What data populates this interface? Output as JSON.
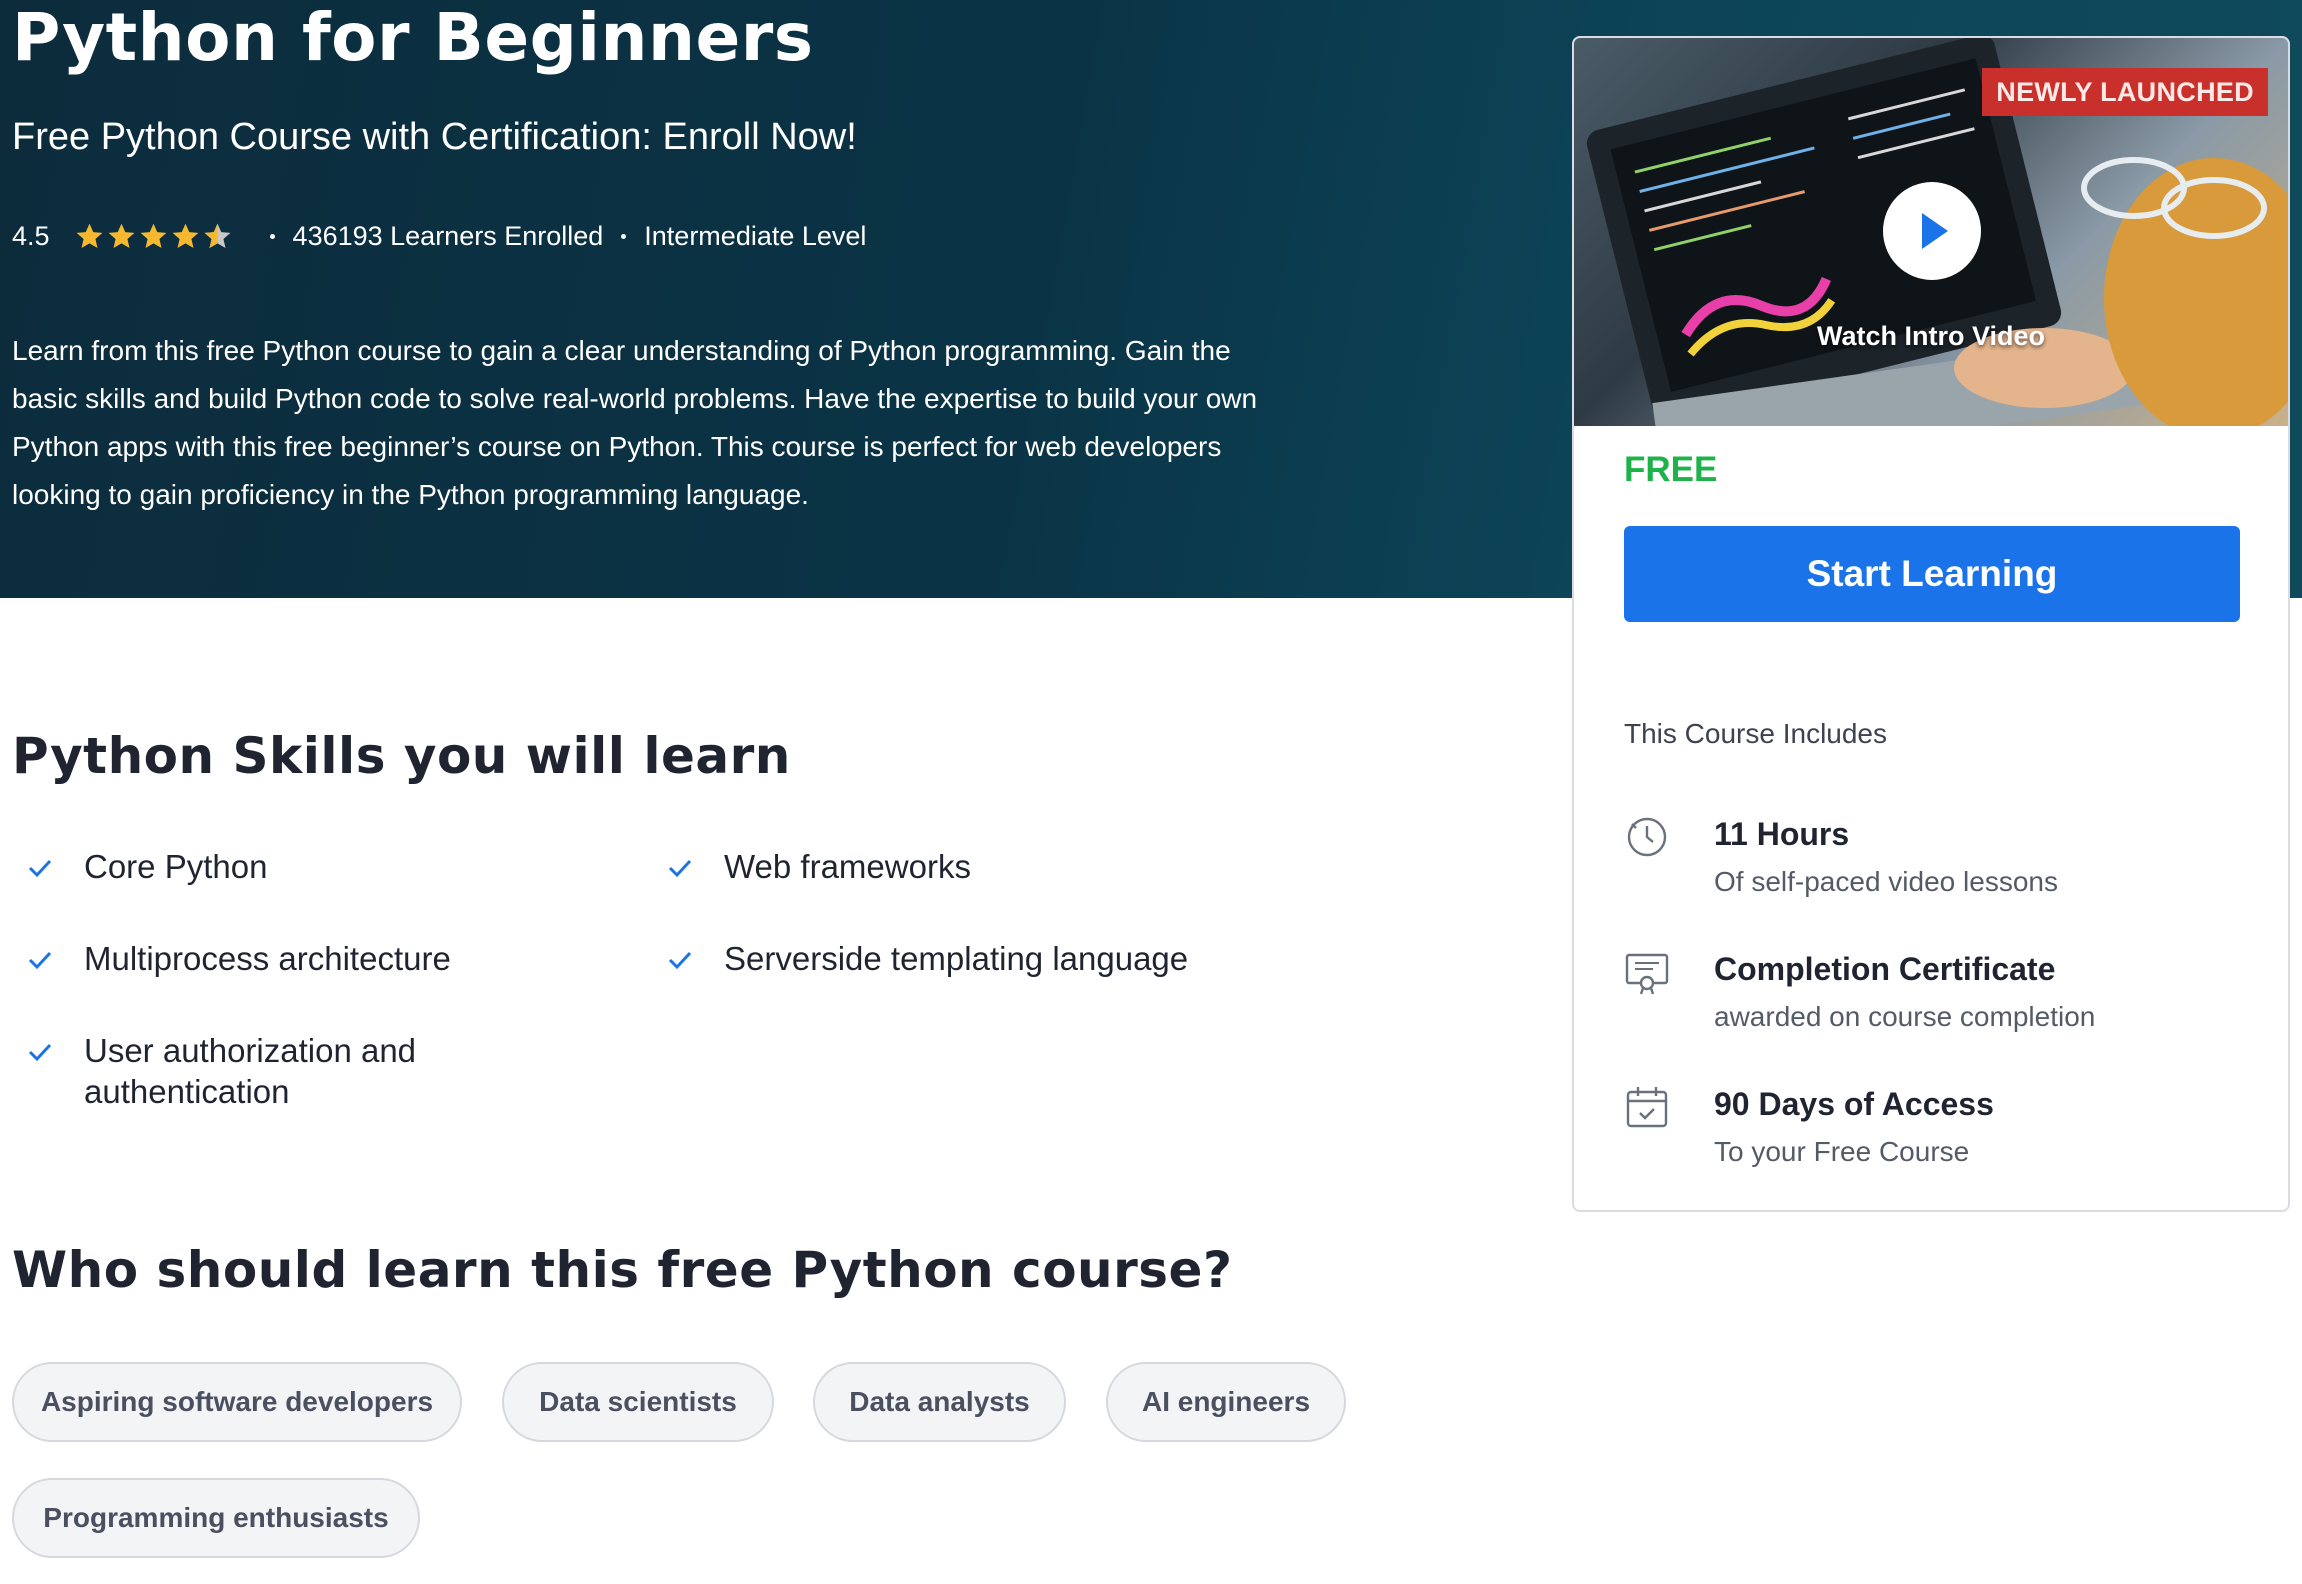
{
  "hero": {
    "title": "Python for Beginners",
    "subtitle": "Free Python Course with Certification: Enroll Now!",
    "rating": "4.5",
    "rating_value": 4.5,
    "rating_max": 5,
    "learners": "436193 Learners Enrolled",
    "level": "Intermediate Level",
    "description": "Learn from this free Python course to gain a clear understanding of Python programming. Gain the basic skills and build Python code to solve real-world problems. Have the expertise to build your own Python apps with this free beginner’s course on Python. This course is perfect for web developers looking to gain proficiency in the Python programming language."
  },
  "skills": {
    "title": "Python Skills you will learn",
    "items": [
      "Core Python",
      "Web frameworks",
      "Multiprocess architecture",
      "Serverside templating language",
      "User authorization and authentication"
    ]
  },
  "audience": {
    "title": "Who should learn this free Python course?",
    "chips": [
      "Aspiring software developers",
      "Data scientists",
      "Data analysts",
      "AI engineers",
      "Programming enthusiasts"
    ]
  },
  "card": {
    "badge": "NEWLY LAUNCHED",
    "watch_label": "Watch Intro Video",
    "price": "FREE",
    "cta": "Start Learning",
    "includes_label": "This Course Includes",
    "includes": [
      {
        "icon": "clock-icon",
        "title": "11 Hours",
        "subtitle": "Of self-paced video lessons"
      },
      {
        "icon": "certificate-icon",
        "title": "Completion Certificate",
        "subtitle": "awarded on course completion"
      },
      {
        "icon": "calendar-icon",
        "title": "90 Days of Access",
        "subtitle": "To your Free Course"
      }
    ]
  },
  "colors": {
    "hero_bg": "#0a3446",
    "accent_blue": "#1a73e8",
    "free_green": "#1db34a",
    "star": "#f5b82e",
    "badge_red": "#c9302c"
  }
}
